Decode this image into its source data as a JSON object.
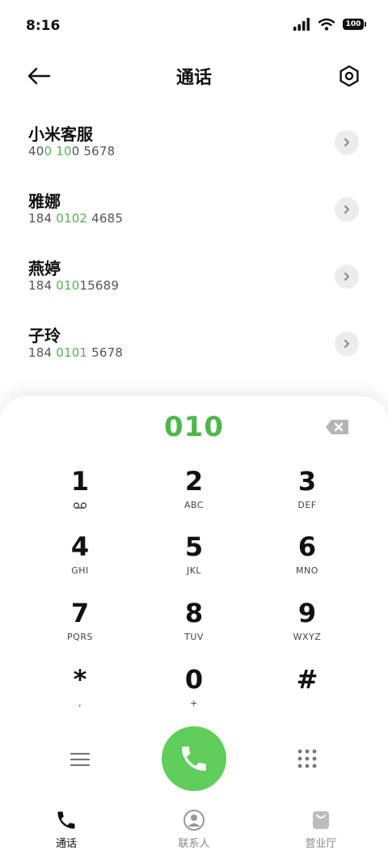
{
  "status_bar": {
    "time": "8:16",
    "battery": "100"
  },
  "header": {
    "title": "通话"
  },
  "contacts": [
    {
      "name": "小米客服",
      "number_parts": [
        "40",
        "0 10",
        "0 5678"
      ]
    },
    {
      "name": "雅娜",
      "number_parts": [
        "184 ",
        "0102",
        " 4685"
      ]
    },
    {
      "name": "燕婷",
      "number_parts": [
        "184 ",
        "010",
        "15689"
      ]
    },
    {
      "name": "子玲",
      "number_parts": [
        "184 ",
        "0101",
        " 5678"
      ]
    }
  ],
  "dialer": {
    "input": "010",
    "keys": [
      {
        "digit": "1",
        "letters": ""
      },
      {
        "digit": "2",
        "letters": "ABC"
      },
      {
        "digit": "3",
        "letters": "DEF"
      },
      {
        "digit": "4",
        "letters": "GHI"
      },
      {
        "digit": "5",
        "letters": "JKL"
      },
      {
        "digit": "6",
        "letters": "MNO"
      },
      {
        "digit": "7",
        "letters": "PQRS"
      },
      {
        "digit": "8",
        "letters": "TUV"
      },
      {
        "digit": "9",
        "letters": "WXYZ"
      },
      {
        "digit": "*",
        "letters": ","
      },
      {
        "digit": "0",
        "letters": "+"
      },
      {
        "digit": "#",
        "letters": ""
      }
    ]
  },
  "bottom_nav": [
    {
      "label": "通话",
      "icon": "phone-icon",
      "active": true
    },
    {
      "label": "联系人",
      "icon": "person-icon",
      "active": false
    },
    {
      "label": "营业厅",
      "icon": "bag-icon",
      "active": false
    }
  ],
  "colors": {
    "accent": "#4cb84c",
    "call_button": "#5fce5a"
  }
}
